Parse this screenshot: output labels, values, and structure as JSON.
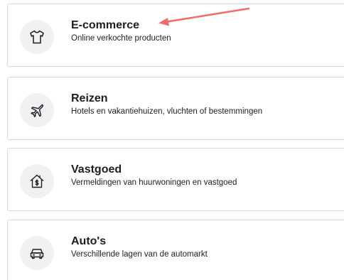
{
  "categories": [
    {
      "title": "E-commerce",
      "subtitle": "Online verkochte producten",
      "icon": "tshirt-icon"
    },
    {
      "title": "Reizen",
      "subtitle": "Hotels en vakantiehuizen, vluchten of bestemmingen",
      "icon": "airplane-icon"
    },
    {
      "title": "Vastgoed",
      "subtitle": "Vermeldingen van huurwoningen en vastgoed",
      "icon": "house-dollar-icon"
    },
    {
      "title": "Auto's",
      "subtitle": "Verschillende lagen van de automarkt",
      "icon": "car-icon"
    }
  ],
  "colors": {
    "icon_background": "#f0f1f3",
    "card_border": "#d9dadd",
    "annotation_arrow": "#f26b6b"
  }
}
